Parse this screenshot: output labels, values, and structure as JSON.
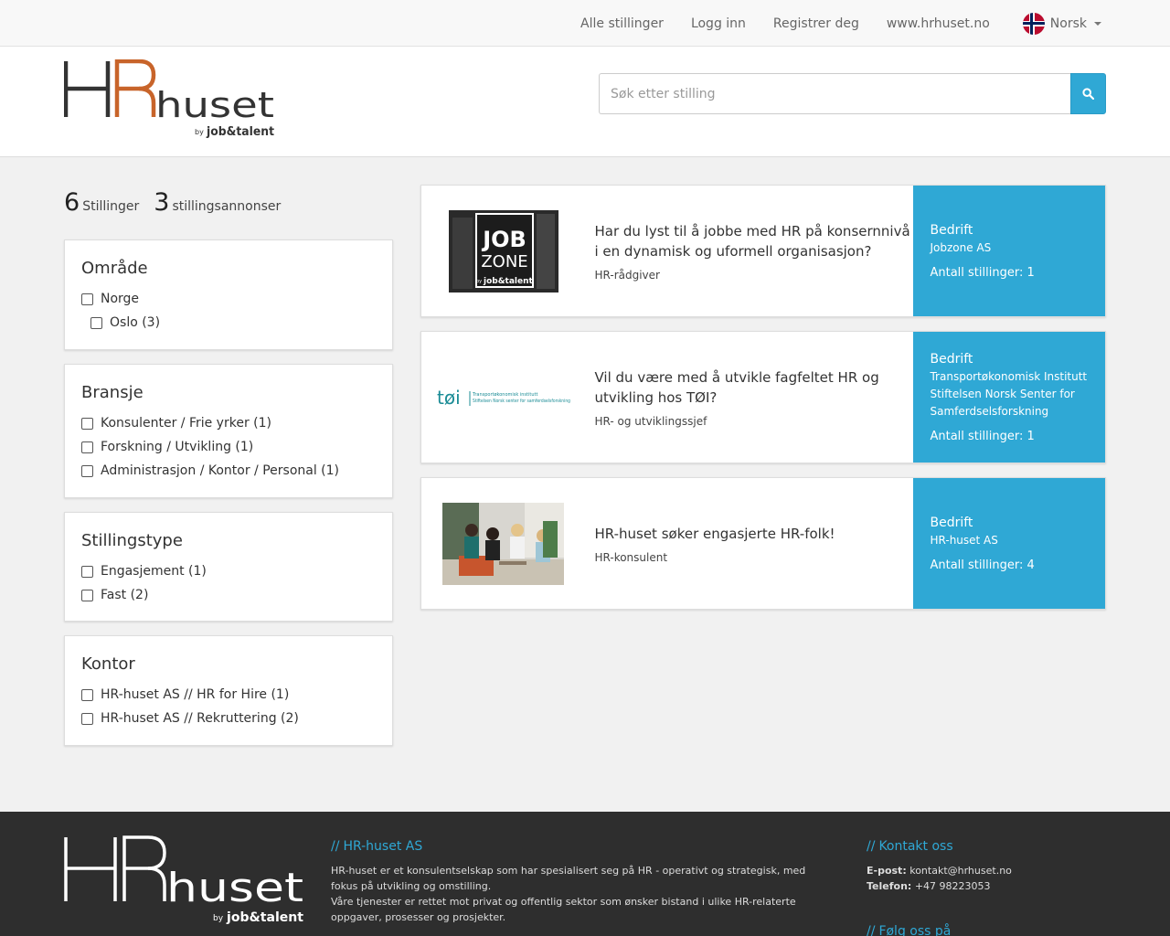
{
  "nav": {
    "links": [
      "Alle stillinger",
      "Logg inn",
      "Registrer deg",
      "www.hrhuset.no"
    ],
    "language": "Norsk"
  },
  "brand": {
    "hr": "HR",
    "huset": "huset",
    "by": "by",
    "partner": "job&talent"
  },
  "search": {
    "placeholder": "Søk etter stilling"
  },
  "counts": {
    "jobs": "6",
    "jobs_label": "Stillinger",
    "ads": "3",
    "ads_label": "stillingsannonser"
  },
  "filters": {
    "omrade": {
      "title": "Område",
      "options": [
        "Norge",
        "Oslo (3)"
      ]
    },
    "bransje": {
      "title": "Bransje",
      "options": [
        "Konsulenter / Frie yrker (1)",
        "Forskning / Utvikling (1)",
        "Administrasjon / Kontor / Personal (1)"
      ]
    },
    "stillingstype": {
      "title": "Stillingstype",
      "options": [
        "Engasjement (1)",
        "Fast (2)"
      ]
    },
    "kontor": {
      "title": "Kontor",
      "options": [
        "HR-huset AS // HR for Hire (1)",
        "HR-huset AS // Rekruttering (2)"
      ]
    }
  },
  "jobs": [
    {
      "title": "Har du lyst til å jobbe med HR på konsernnivå i en dynamisk og uformell organisasjon?",
      "role": "HR-rådgiver",
      "company_label": "Bedrift",
      "company": [
        "Jobzone AS"
      ],
      "count": "Antall stillinger: 1",
      "logo": {
        "line1": "JOB",
        "line2": "ZONE",
        "by": "by",
        "partner": "job&talent"
      }
    },
    {
      "title": "Vil du være med å utvikle fagfeltet HR og utvikling hos TØI?",
      "role": "HR- og utviklingssjef",
      "company_label": "Bedrift",
      "company": [
        "Transportøkonomisk Institutt",
        "Stiftelsen Norsk Senter for",
        "Samferdselsforskning"
      ],
      "count": "Antall stillinger: 1",
      "logo": {
        "mark": "tøi",
        "line1": "Transportøkonomisk institutt",
        "line2": "Stiftelsen Norsk senter for samferdselsforskning"
      }
    },
    {
      "title": "HR-huset søker engasjerte HR-folk!",
      "role": "HR-konsulent",
      "company_label": "Bedrift",
      "company": [
        "HR-huset AS"
      ],
      "count": "Antall stillinger: 4"
    }
  ],
  "footer": {
    "about_heading": "HR-huset AS",
    "about_lines": [
      "HR-huset er et konsulentselskap som har spesialisert seg på HR - operativt og strategisk, med fokus på utvikling og omstilling.",
      "Våre tjenester er rettet mot privat og offentlig sektor som ønsker bistand i ulike HR-relaterte oppgaver, prosesser og prosjekter."
    ],
    "contact_heading": "Kontakt oss",
    "email_label": "E-post:",
    "email": "kontakt@hrhuset.no",
    "phone_label": "Telefon:",
    "phone": "+47 98223053",
    "follow_heading": "Følg oss på",
    "slashes": "//"
  },
  "colors": {
    "accent": "#2fa8d5",
    "brand_orange": "#c8642a",
    "footer_bg": "#2e2e2e"
  },
  "icons": {
    "search": "search-icon",
    "flag": "norway-flag-icon",
    "caret": "chevron-down-icon"
  }
}
